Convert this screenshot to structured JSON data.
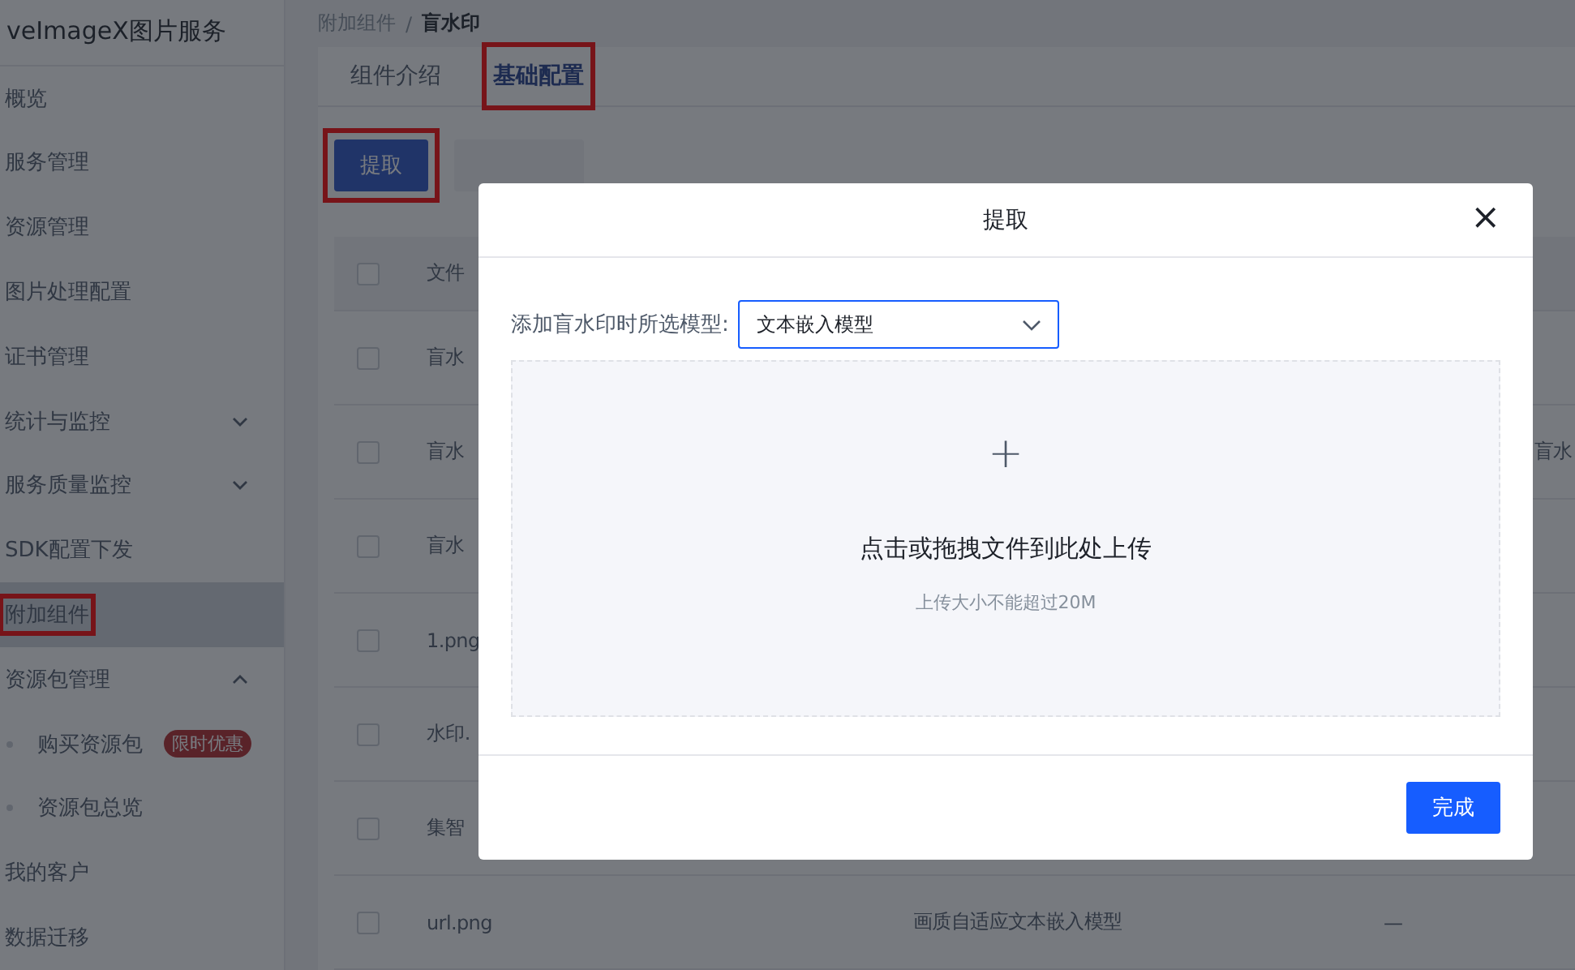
{
  "sidebar": {
    "title": "veImageX图片服务",
    "items": [
      {
        "label": "概览",
        "selected": false,
        "highlighted": false
      },
      {
        "label": "服务管理",
        "selected": false,
        "highlighted": false
      },
      {
        "label": "资源管理",
        "selected": false,
        "highlighted": false
      },
      {
        "label": "图片处理配置",
        "selected": false,
        "highlighted": false
      },
      {
        "label": "证书管理",
        "selected": false,
        "highlighted": false
      },
      {
        "label": "统计与监控",
        "selected": false,
        "highlighted": false,
        "expanded": false
      },
      {
        "label": "服务质量监控",
        "selected": false,
        "highlighted": false,
        "expanded": false
      },
      {
        "label": "SDK配置下发",
        "selected": false,
        "highlighted": false
      },
      {
        "label": "附加组件",
        "selected": true,
        "highlighted": true
      },
      {
        "label": "资源包管理",
        "selected": false,
        "highlighted": false,
        "expanded": true,
        "children": [
          {
            "label": "购买资源包",
            "badge": "限时优惠",
            "selected": false,
            "highlighted": false
          },
          {
            "label": "资源包总览",
            "selected": false,
            "highlighted": false
          }
        ]
      },
      {
        "label": "我的客户",
        "selected": false,
        "highlighted": false
      },
      {
        "label": "数据迁移",
        "selected": false,
        "highlighted": false
      }
    ]
  },
  "breadcrumb": [
    "附加组件",
    "盲水印"
  ],
  "breadcrumb_separator": "/",
  "tabs": [
    {
      "label": "组件介绍",
      "selected": false,
      "highlighted": false
    },
    {
      "label": "基础配置",
      "selected": true,
      "highlighted": true
    }
  ],
  "actions": [
    {
      "kind": "primary",
      "label": "提取",
      "highlighted": true
    },
    {
      "kind": "secondary",
      "highlighted": false
    }
  ],
  "table": {
    "header": {
      "checked": false,
      "column_2": "文件"
    },
    "rows": [
      {
        "checked": false,
        "column_2": "盲水"
      },
      {
        "checked": false,
        "column_2": "盲水",
        "column_5": "盲水"
      },
      {
        "checked": false,
        "column_2": "盲水"
      },
      {
        "checked": false,
        "column_2": "1.png"
      },
      {
        "checked": false,
        "column_2": "水印."
      },
      {
        "checked": false,
        "column_2": "集智"
      },
      {
        "checked": false,
        "column_2": "url.png",
        "column_3": "画质自适应文本嵌入模型",
        "column_4": "—"
      }
    ]
  },
  "dialog": {
    "title": "提取",
    "close": "×",
    "model_label": "添加盲水印时所选模型:",
    "model_value": "文本嵌入模型",
    "upload": {
      "icon": "+",
      "text": "点击或拖拽文件到此处上传",
      "hint": "上传大小不能超过20M"
    },
    "confirm": "完成"
  }
}
